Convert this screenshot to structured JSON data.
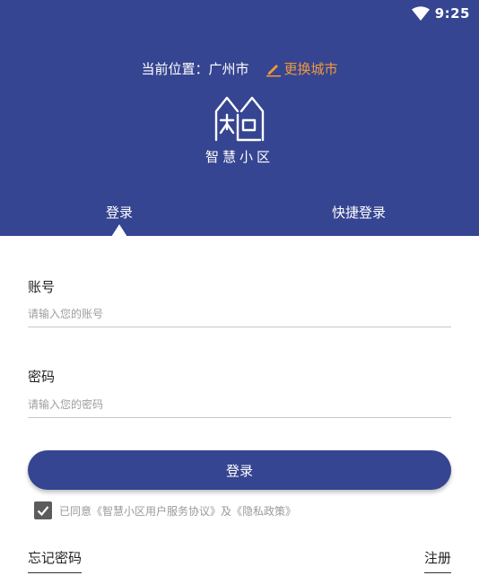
{
  "status_bar": {
    "time": "9:25",
    "wifi_icon": "wifi-icon"
  },
  "location": {
    "label": "当前位置：",
    "city": "广州市",
    "change_label": "更换城市",
    "change_icon": "pencil-icon",
    "accent_color": "#f0993a"
  },
  "brand": {
    "name": "智慧小区",
    "logo_icon": "house-logo-icon",
    "primary_color": "#364591"
  },
  "tabs": [
    {
      "label": "登录",
      "active": true
    },
    {
      "label": "快捷登录",
      "active": false
    }
  ],
  "form": {
    "account": {
      "label": "账号",
      "placeholder": "请输入您的账号",
      "value": ""
    },
    "password": {
      "label": "密码",
      "placeholder": "请输入您的密码",
      "value": ""
    },
    "submit_label": "登录"
  },
  "agreement": {
    "checked": true,
    "prefix": "已同意",
    "user_agreement": "《智慧小区用户服务协议》",
    "joiner": "及",
    "privacy_policy": "《隐私政策》"
  },
  "links": {
    "forgot_password": "忘记密码",
    "register": "注册"
  }
}
